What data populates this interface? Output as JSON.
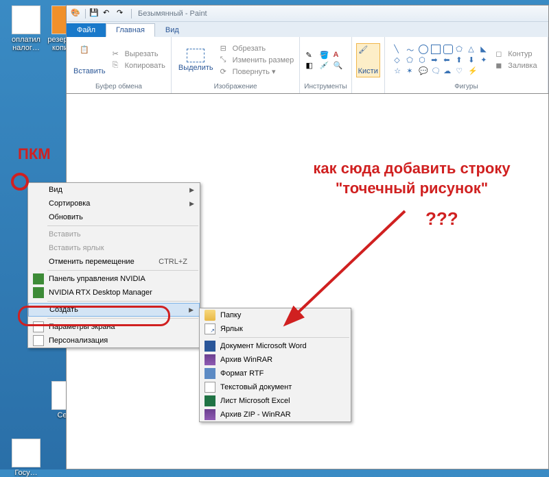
{
  "desktop": {
    "icons": [
      {
        "label": "оплатил\nналог…"
      },
      {
        "label": "резервная\nкопия…"
      },
      {
        "label": "Се…"
      },
      {
        "label": "Госу…"
      }
    ]
  },
  "paint_window": {
    "title": "Безымянный - Paint",
    "tabs": {
      "file": "Файл",
      "home": "Главная",
      "view": "Вид"
    },
    "clipboard": {
      "paste": "Вставить",
      "cut": "Вырезать",
      "copy": "Копировать",
      "label": "Буфер обмена"
    },
    "image": {
      "select": "Выделить",
      "crop": "Обрезать",
      "resize": "Изменить размер",
      "rotate": "Повернуть ▾",
      "label": "Изображение"
    },
    "tools": {
      "label": "Инструменты"
    },
    "brushes": {
      "btn": "Кисти",
      "label": ""
    },
    "shapes": {
      "label": "Фигуры",
      "outline": "Контур",
      "fill": "Заливка"
    }
  },
  "context_menu": {
    "items": [
      {
        "label": "Вид",
        "arrow": true
      },
      {
        "label": "Сортировка",
        "arrow": true
      },
      {
        "label": "Обновить"
      },
      {
        "sep": true
      },
      {
        "label": "Вставить",
        "disabled": true
      },
      {
        "label": "Вставить ярлык",
        "disabled": true
      },
      {
        "label": "Отменить перемещение",
        "shortcut": "CTRL+Z"
      },
      {
        "sep": true
      },
      {
        "label": "Панель управления NVIDIA",
        "icon": "nvidia"
      },
      {
        "label": "NVIDIA RTX Desktop Manager",
        "icon": "nvidia"
      },
      {
        "sep": true
      },
      {
        "label": "Создать",
        "arrow": true,
        "hover": true
      },
      {
        "sep": true
      },
      {
        "label": "Параметры экрана",
        "icon": "gear"
      },
      {
        "label": "Персонализация",
        "icon": "gear"
      }
    ]
  },
  "submenu": {
    "items": [
      {
        "label": "Папку",
        "icon": "folder"
      },
      {
        "label": "Ярлык",
        "icon": "link"
      },
      {
        "sep": true
      },
      {
        "label": "Документ Microsoft Word",
        "icon": "word"
      },
      {
        "label": "Архив WinRAR",
        "icon": "rar"
      },
      {
        "label": "Формат RTF",
        "icon": "rtf"
      },
      {
        "label": "Текстовый документ",
        "icon": "txt"
      },
      {
        "label": "Лист Microsoft Excel",
        "icon": "excel"
      },
      {
        "label": "Архив ZIP - WinRAR",
        "icon": "rar"
      }
    ]
  },
  "annotations": {
    "pkm": "ПКМ",
    "question": "как сюда добавить строку \"точечный рисунок\"",
    "qqq": "???"
  }
}
